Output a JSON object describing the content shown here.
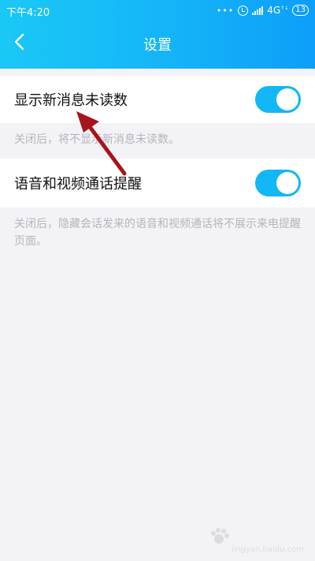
{
  "status_bar": {
    "time": "下午4:20",
    "network": "4G",
    "network_sup": "↑↓",
    "battery": "13",
    "icons": [
      "notification-dots-icon",
      "alarm-icon",
      "signal-icon",
      "battery-icon"
    ]
  },
  "header": {
    "title": "设置",
    "back_icon": "back-arrow-icon"
  },
  "settings": [
    {
      "label": "显示新消息未读数",
      "enabled": true,
      "hint": "关闭后，将不显示新消息未读数。"
    },
    {
      "label": "语音和视频通话提醒",
      "enabled": true,
      "hint": "关闭后，隐藏会话发来的语音和视频通话将不展示来电提醒页面。"
    }
  ],
  "watermark": {
    "url": "jingyan.baidu.com"
  },
  "colors": {
    "header_gradient_start": "#1ac8f6",
    "header_gradient_end": "#0d9ef9",
    "toggle_on": "#12b7f5",
    "annotation_arrow": "#a8141c",
    "page_background": "#f3f3f7"
  }
}
